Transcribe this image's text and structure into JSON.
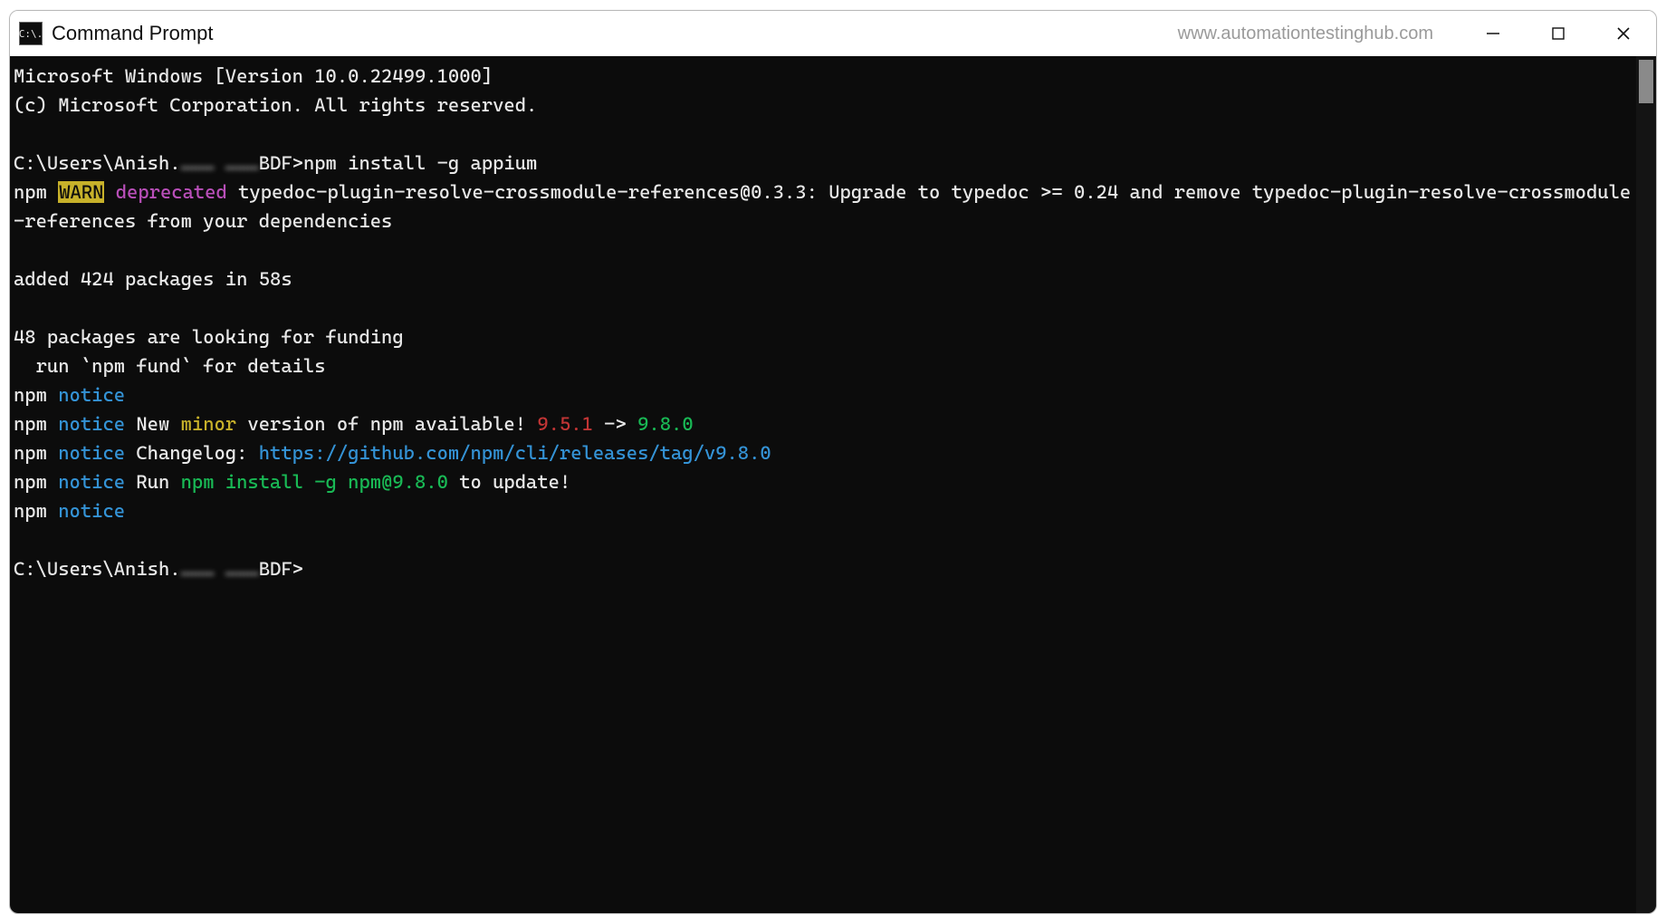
{
  "titlebar": {
    "icon_label": "C:\\.",
    "title": "Command Prompt",
    "watermark": "www.automationtestinghub.com"
  },
  "colors": {
    "bg": "#0c0c0c",
    "fg": "#e8e8e8",
    "link": "#3493d6",
    "green": "#19b955",
    "red": "#c23535",
    "yellow": "#c7b12a",
    "magenta": "#b94fb9"
  },
  "terminal": {
    "banner1": "Microsoft Windows [Version 10.0.22499.1000]",
    "banner2": "(c) Microsoft Corporation. All rights reserved.",
    "prompt_pre": "C:\\Users\\Anish.",
    "prompt_redacted": "……… ………",
    "prompt_post": "BDF>",
    "command": "npm install -g appium",
    "warn_npm": "npm ",
    "warn_badge": "WARN",
    "warn_deprecated": " deprecated",
    "warn_tail": " typedoc-plugin-resolve-crossmodule-references@0.3.3: Upgrade to typedoc >= 0.24 and remove typedoc-plugin-resolve-crossmodule-references from your dependencies",
    "added": "added 424 packages in 58s",
    "funding1": "48 packages are looking for funding",
    "funding2": "  run `npm fund` for details",
    "notice_npm": "npm ",
    "notice_word": "notice",
    "notice_new_pre": " New ",
    "notice_minor": "minor",
    "notice_new_post": " version of npm available! ",
    "notice_oldver": "9.5.1",
    "notice_arrow": " -> ",
    "notice_newver": "9.8.0",
    "notice_changelog_pre": " Changelog: ",
    "notice_changelog_url": "https://github.com/npm/cli/releases/tag/v9.8.0",
    "notice_run_pre": " Run ",
    "notice_run_cmd": "npm install -g npm@9.8.0",
    "notice_run_post": " to update!"
  }
}
